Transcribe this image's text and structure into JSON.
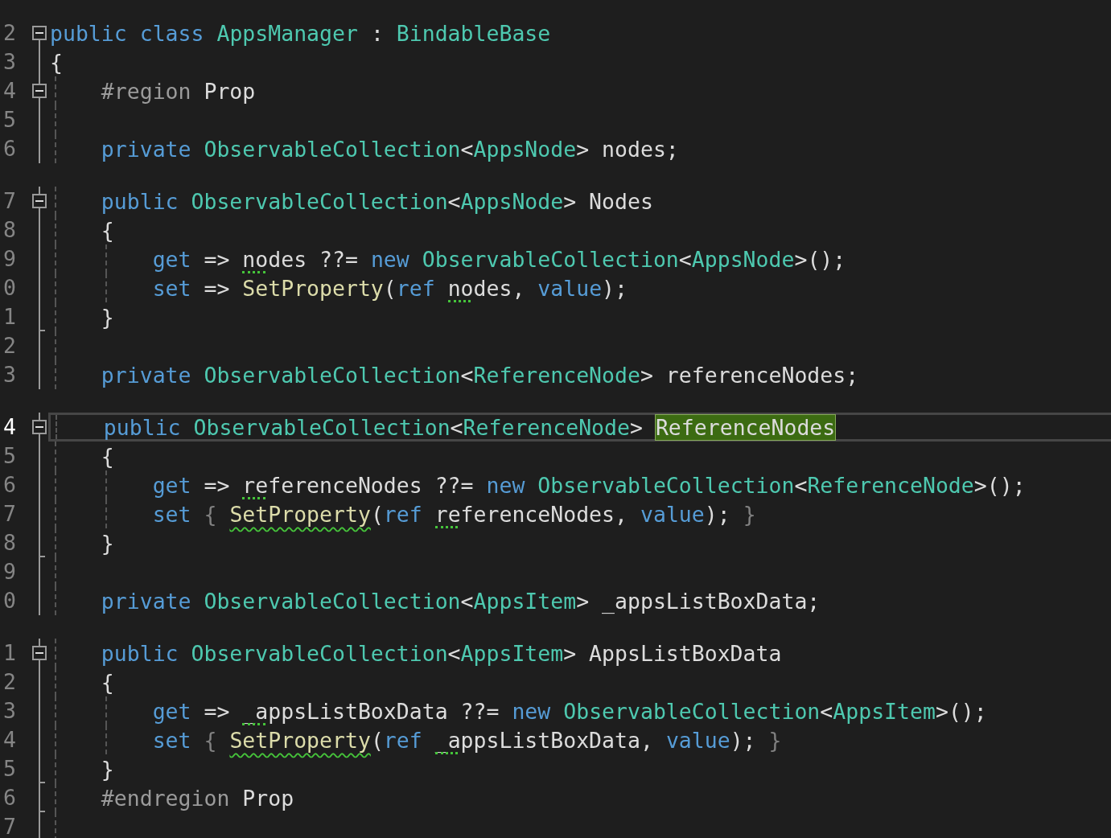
{
  "editor": {
    "lines": [
      {
        "number": "2",
        "collapsible": true,
        "kind": "level0",
        "tokens": [
          {
            "kind": "kw",
            "t": "public class "
          },
          {
            "kind": "type",
            "t": "AppsManager"
          },
          {
            "kind": "plain",
            "t": " : "
          },
          {
            "kind": "type",
            "t": "BindableBase"
          }
        ]
      },
      {
        "number": "3",
        "kind": "level0",
        "tokens": [
          {
            "kind": "plain",
            "t": "{"
          }
        ]
      },
      {
        "number": "4",
        "collapsible": true,
        "kind": "level1",
        "tokens": [
          {
            "kind": "preproc",
            "t": "#region "
          },
          {
            "kind": "plain",
            "t": "Prop"
          }
        ]
      },
      {
        "number": "5"
      },
      {
        "number": "6",
        "kind": "level1",
        "tokens": [
          {
            "kind": "kw",
            "t": "private "
          },
          {
            "kind": "type",
            "t": "ObservableCollection"
          },
          {
            "kind": "plain",
            "t": "<"
          },
          {
            "kind": "type",
            "t": "AppsNode"
          },
          {
            "kind": "plain",
            "t": "> nodes;"
          }
        ]
      },
      {
        "number": "7",
        "collapsible": true,
        "kind": "level1",
        "gap": true,
        "tokens": [
          {
            "kind": "kw",
            "t": "public "
          },
          {
            "kind": "type",
            "t": "ObservableCollection"
          },
          {
            "kind": "plain",
            "t": "<"
          },
          {
            "kind": "type",
            "t": "AppsNode"
          },
          {
            "kind": "plain",
            "t": "> Nodes"
          }
        ]
      },
      {
        "number": "8",
        "kind": "level1",
        "tokens": [
          {
            "kind": "plain",
            "t": "{"
          }
        ]
      },
      {
        "number": "9",
        "kind": "level2",
        "tokens": [
          {
            "kind": "kw",
            "t": "get "
          },
          {
            "kind": "plain",
            "t": "=> "
          },
          {
            "kind": "plain",
            "t": "nodes",
            "suggestion": true
          },
          {
            "kind": "plain",
            "t": " ??= "
          },
          {
            "kind": "kw",
            "t": "new "
          },
          {
            "kind": "type",
            "t": "ObservableCollection"
          },
          {
            "kind": "plain",
            "t": "<"
          },
          {
            "kind": "type",
            "t": "AppsNode"
          },
          {
            "kind": "plain",
            "t": ">();"
          }
        ]
      },
      {
        "number": "0",
        "kind": "level2",
        "tokens": [
          {
            "kind": "kw",
            "t": "set "
          },
          {
            "kind": "plain",
            "t": "=> "
          },
          {
            "kind": "method",
            "t": "SetProperty"
          },
          {
            "kind": "plain",
            "t": "("
          },
          {
            "kind": "kw",
            "t": "ref "
          },
          {
            "kind": "plain",
            "t": "nodes",
            "suggestion": true
          },
          {
            "kind": "plain",
            "t": ", "
          },
          {
            "kind": "kw",
            "t": "value"
          },
          {
            "kind": "plain",
            "t": ");"
          }
        ]
      },
      {
        "number": "1",
        "fold_end": true,
        "kind": "level1",
        "tokens": [
          {
            "kind": "plain",
            "t": "}"
          }
        ]
      },
      {
        "number": "2"
      },
      {
        "number": "3",
        "kind": "level1",
        "tokens": [
          {
            "kind": "kw",
            "t": "private "
          },
          {
            "kind": "type",
            "t": "ObservableCollection"
          },
          {
            "kind": "plain",
            "t": "<"
          },
          {
            "kind": "type",
            "t": "ReferenceNode"
          },
          {
            "kind": "plain",
            "t": "> referenceNodes;"
          }
        ]
      },
      {
        "number": "4",
        "collapsible": true,
        "kind": "level1",
        "gap": true,
        "current": true,
        "tokens": [
          {
            "kind": "kw",
            "t": "public "
          },
          {
            "kind": "type",
            "t": "ObservableCollection"
          },
          {
            "kind": "plain",
            "t": "<"
          },
          {
            "kind": "type",
            "t": "ReferenceNode"
          },
          {
            "kind": "plain",
            "t": "> "
          },
          {
            "kind": "plain",
            "t": "ReferenceNodes",
            "highlight": true
          }
        ]
      },
      {
        "number": "5",
        "kind": "level1",
        "tokens": [
          {
            "kind": "plain",
            "t": "{"
          }
        ]
      },
      {
        "number": "6",
        "kind": "level2",
        "tokens": [
          {
            "kind": "kw",
            "t": "get "
          },
          {
            "kind": "plain",
            "t": "=> "
          },
          {
            "kind": "plain",
            "t": "referenceNodes",
            "suggestion": true
          },
          {
            "kind": "plain",
            "t": " ??= "
          },
          {
            "kind": "kw",
            "t": "new "
          },
          {
            "kind": "type",
            "t": "ObservableCollection"
          },
          {
            "kind": "plain",
            "t": "<"
          },
          {
            "kind": "type",
            "t": "ReferenceNode"
          },
          {
            "kind": "plain",
            "t": ">();"
          }
        ]
      },
      {
        "number": "7",
        "kind": "level2",
        "tokens": [
          {
            "kind": "kw",
            "t": "set "
          },
          {
            "kind": "dim",
            "t": "{ "
          },
          {
            "kind": "method",
            "t": "SetProperty",
            "error": true
          },
          {
            "kind": "plain",
            "t": "("
          },
          {
            "kind": "kw",
            "t": "ref "
          },
          {
            "kind": "plain",
            "t": "referenceNodes",
            "suggestion": true
          },
          {
            "kind": "plain",
            "t": ", "
          },
          {
            "kind": "kw",
            "t": "value"
          },
          {
            "kind": "plain",
            "t": ");"
          },
          {
            "kind": "dim",
            "t": " }"
          }
        ]
      },
      {
        "number": "8",
        "fold_end": true,
        "kind": "level1",
        "tokens": [
          {
            "kind": "plain",
            "t": "}"
          }
        ]
      },
      {
        "number": "9"
      },
      {
        "number": "0",
        "kind": "level1",
        "tokens": [
          {
            "kind": "kw",
            "t": "private "
          },
          {
            "kind": "type",
            "t": "ObservableCollection"
          },
          {
            "kind": "plain",
            "t": "<"
          },
          {
            "kind": "type",
            "t": "AppsItem"
          },
          {
            "kind": "plain",
            "t": "> _appsListBoxData;"
          }
        ]
      },
      {
        "number": "1",
        "collapsible": true,
        "kind": "level1",
        "gap": true,
        "tokens": [
          {
            "kind": "kw",
            "t": "public "
          },
          {
            "kind": "type",
            "t": "ObservableCollection"
          },
          {
            "kind": "plain",
            "t": "<"
          },
          {
            "kind": "type",
            "t": "AppsItem"
          },
          {
            "kind": "plain",
            "t": "> AppsListBoxData"
          }
        ]
      },
      {
        "number": "2",
        "kind": "level1",
        "tokens": [
          {
            "kind": "plain",
            "t": "{"
          }
        ]
      },
      {
        "number": "3",
        "kind": "level2",
        "tokens": [
          {
            "kind": "kw",
            "t": "get "
          },
          {
            "kind": "plain",
            "t": "=> "
          },
          {
            "kind": "plain",
            "t": "_appsListBoxData",
            "suggestion": true
          },
          {
            "kind": "plain",
            "t": " ??= "
          },
          {
            "kind": "kw",
            "t": "new "
          },
          {
            "kind": "type",
            "t": "ObservableCollection"
          },
          {
            "kind": "plain",
            "t": "<"
          },
          {
            "kind": "type",
            "t": "AppsItem"
          },
          {
            "kind": "plain",
            "t": ">();"
          }
        ]
      },
      {
        "number": "4",
        "kind": "level2",
        "tokens": [
          {
            "kind": "kw",
            "t": "set "
          },
          {
            "kind": "dim",
            "t": "{ "
          },
          {
            "kind": "method",
            "t": "SetProperty",
            "error": true
          },
          {
            "kind": "plain",
            "t": "("
          },
          {
            "kind": "kw",
            "t": "ref "
          },
          {
            "kind": "plain",
            "t": "_appsListBoxData",
            "suggestion": true
          },
          {
            "kind": "plain",
            "t": ", "
          },
          {
            "kind": "kw",
            "t": "value"
          },
          {
            "kind": "plain",
            "t": ");"
          },
          {
            "kind": "dim",
            "t": " }"
          }
        ]
      },
      {
        "number": "5",
        "fold_end": true,
        "kind": "level1",
        "tokens": [
          {
            "kind": "plain",
            "t": "}"
          }
        ]
      },
      {
        "number": "6",
        "fold_end": true,
        "kind": "level1",
        "tokens": [
          {
            "kind": "preproc",
            "t": "#endregion "
          },
          {
            "kind": "plain",
            "t": "Prop"
          }
        ]
      },
      {
        "number": "7"
      }
    ]
  }
}
